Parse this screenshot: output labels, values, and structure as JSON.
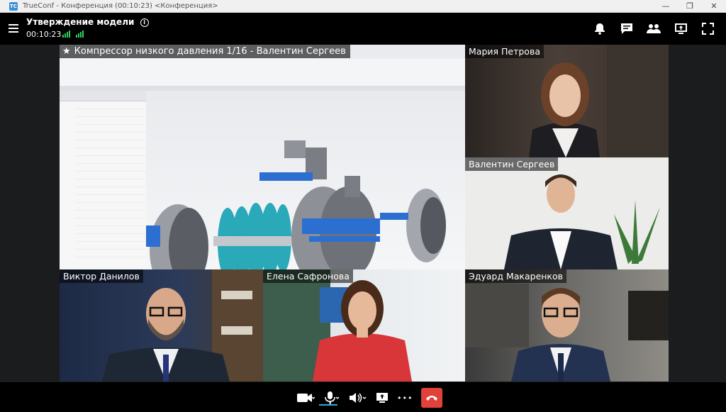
{
  "window": {
    "title": "TrueConf - Конференция (00:10:23) <Конференция>",
    "app_icon_text": "TC",
    "minimize_glyph": "—",
    "maximize_glyph": "❐",
    "close_glyph": "✕"
  },
  "header": {
    "conference_title": "Утверждение модели",
    "info_glyph": "i",
    "timer": "00:10:23",
    "signal_color": "#33cc55",
    "actions": [
      "bell-icon",
      "chat-icon",
      "participants-icon",
      "share-screen-icon",
      "fullscreen-icon"
    ]
  },
  "shared_screen": {
    "title": "Компрессор низкого давления 1/16 - Валентин Сергеев",
    "star_glyph": "★",
    "content": "CAD model of compressor"
  },
  "participants": [
    {
      "name": "Мария Петрова"
    },
    {
      "name": "Валентин Сергеев"
    },
    {
      "name": "Виктор Данилов"
    },
    {
      "name": "Елена Сафронова"
    },
    {
      "name": "Эдуард Макаренков"
    }
  ],
  "toolbar": {
    "hangup_color": "#e0423a",
    "mic_active_color": "#2ea8d8",
    "more_glyph": "•••"
  }
}
